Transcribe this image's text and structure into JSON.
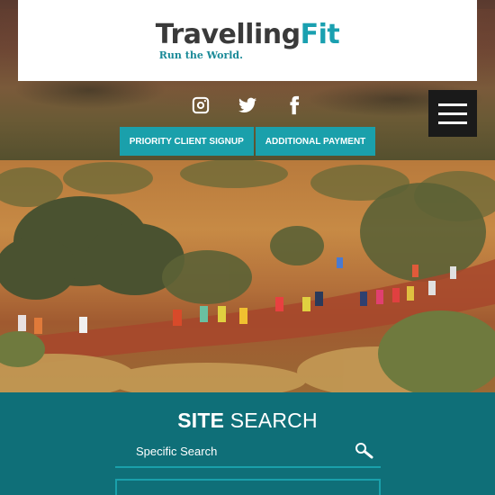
{
  "header": {
    "logo": {
      "word_main": "Travelling",
      "word_accent": "Fit",
      "tagline": "Run the World."
    },
    "social": [
      {
        "icon": "instagram-icon"
      },
      {
        "icon": "twitter-icon"
      },
      {
        "icon": "facebook-icon"
      }
    ],
    "menu_icon": "hamburger-menu-icon",
    "buttons": {
      "priority_signup": "PRIORITY CLIENT SIGNUP",
      "additional_payment": "ADDITIONAL PAYMENT"
    }
  },
  "colors": {
    "teal_button": "#1aa0ab",
    "search_bg": "#0f6f78",
    "logo_dark": "#3a3a3a",
    "logo_accent": "#1aa0b0"
  },
  "search": {
    "title_bold": "SITE",
    "title_light": "SEARCH",
    "placeholder": "Specific Search"
  }
}
